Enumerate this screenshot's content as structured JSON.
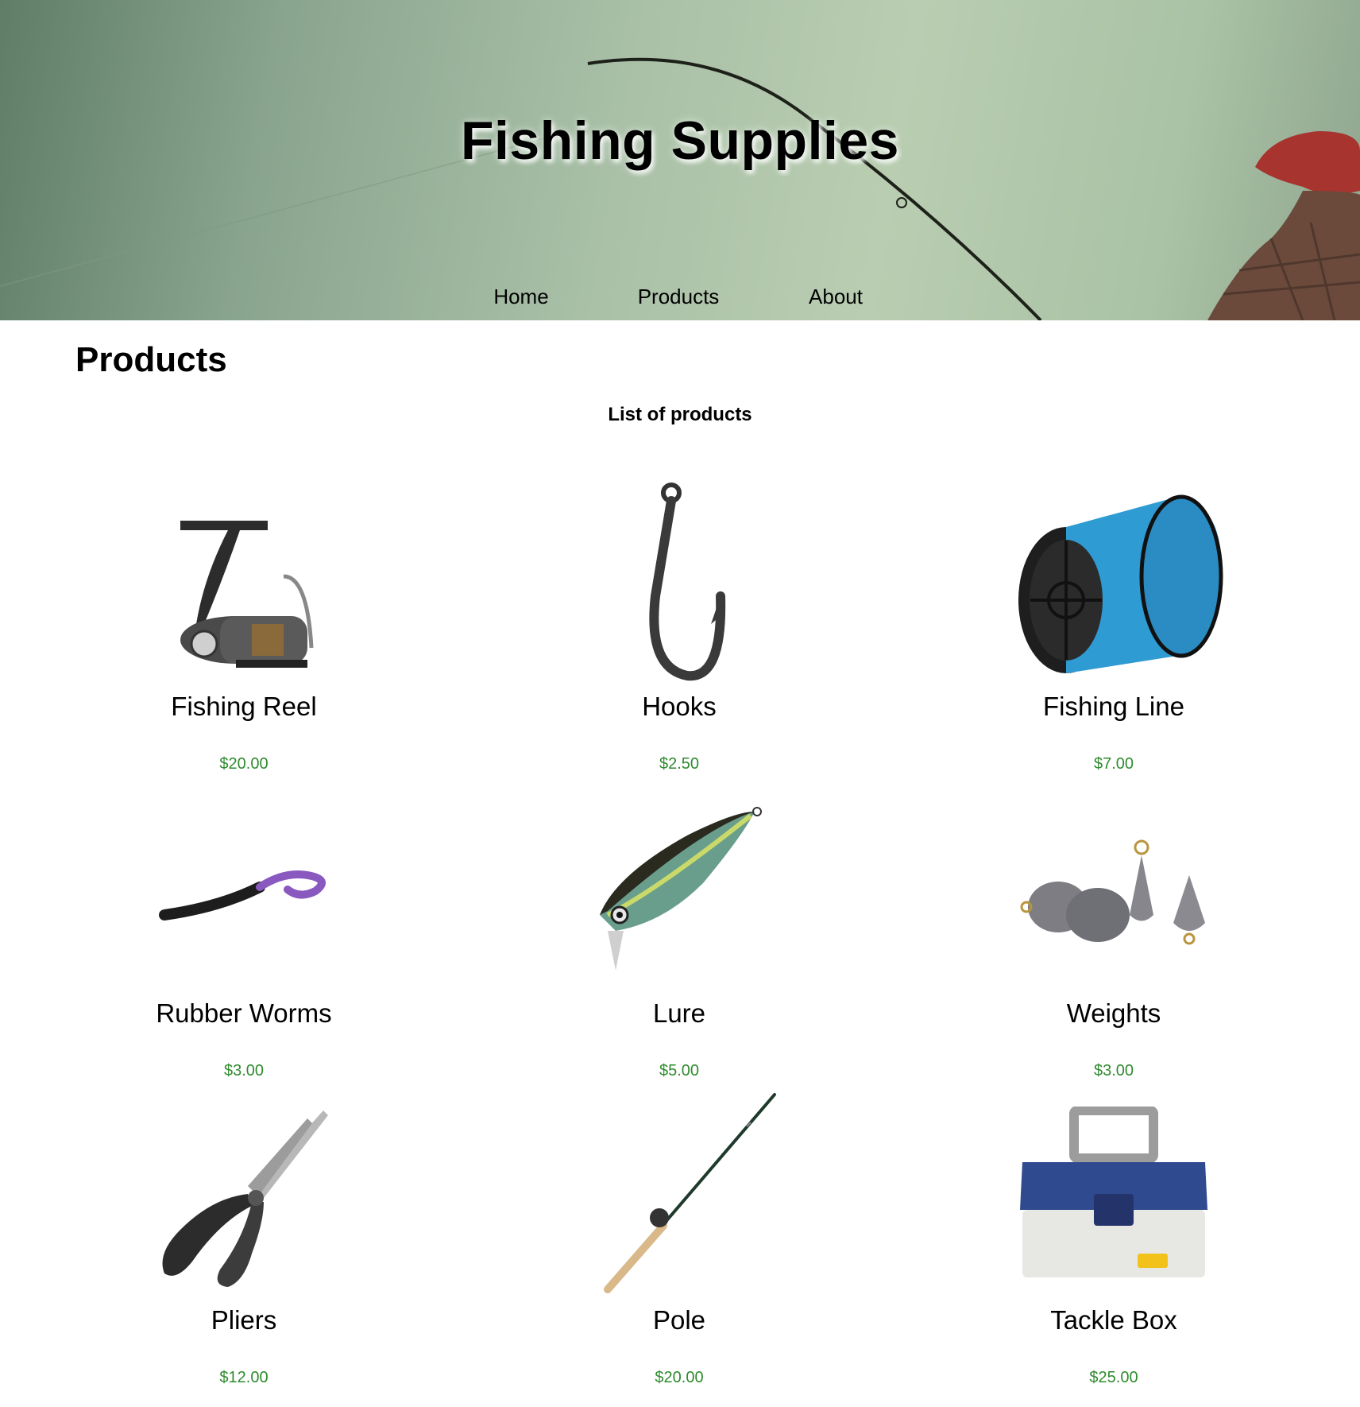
{
  "header": {
    "site_title": "Fishing Supplies",
    "nav": [
      {
        "label": "Home"
      },
      {
        "label": "Products"
      },
      {
        "label": "About"
      }
    ]
  },
  "main": {
    "heading": "Products",
    "subheading": "List of products",
    "products": [
      {
        "name": "Fishing Reel",
        "price": "$20.00",
        "icon": "fishing-reel-icon"
      },
      {
        "name": "Hooks",
        "price": "$2.50",
        "icon": "hook-icon"
      },
      {
        "name": "Fishing Line",
        "price": "$7.00",
        "icon": "line-spool-icon"
      },
      {
        "name": "Rubber Worms",
        "price": "$3.00",
        "icon": "rubber-worm-icon"
      },
      {
        "name": "Lure",
        "price": "$5.00",
        "icon": "lure-icon"
      },
      {
        "name": "Weights",
        "price": "$3.00",
        "icon": "weights-icon"
      },
      {
        "name": "Pliers",
        "price": "$12.00",
        "icon": "pliers-icon"
      },
      {
        "name": "Pole",
        "price": "$20.00",
        "icon": "fishing-pole-icon"
      },
      {
        "name": "Tackle Box",
        "price": "$25.00",
        "icon": "tackle-box-icon"
      }
    ]
  },
  "colors": {
    "price": "#2e8b2e",
    "hero_tint": "#a9c0a7"
  }
}
